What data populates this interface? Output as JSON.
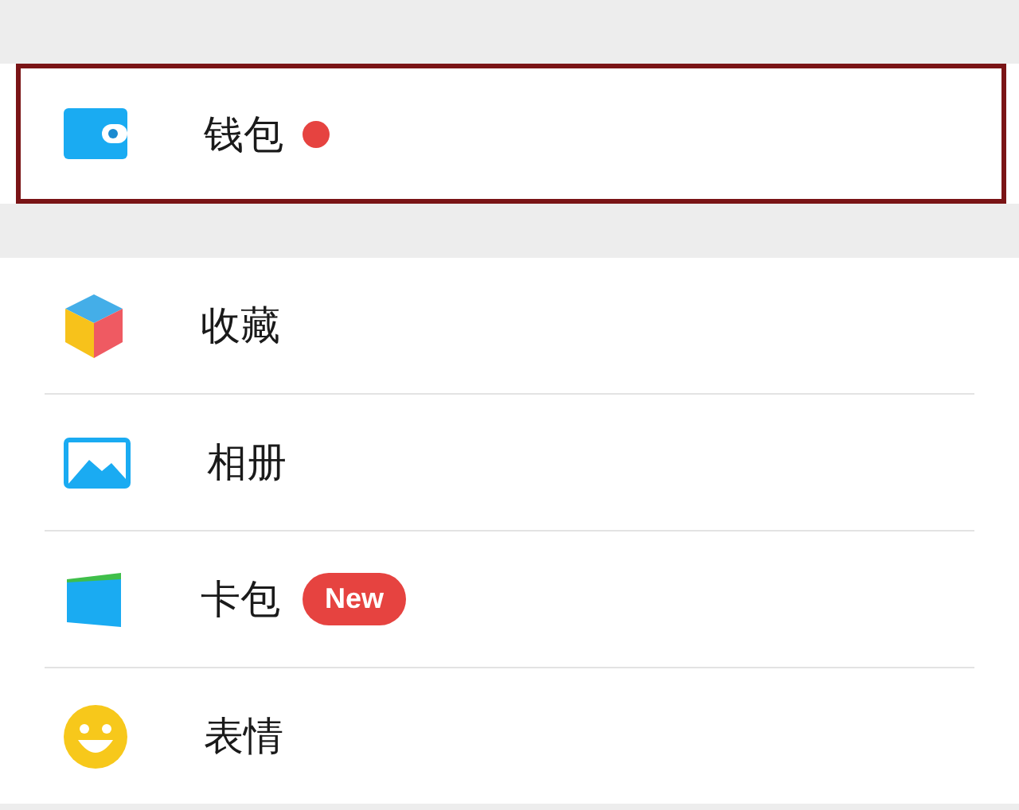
{
  "top_group": [
    {
      "label": "钱包",
      "kind": "wallet",
      "highlighted": true,
      "badge": {
        "kind": "dot"
      }
    }
  ],
  "main_group": [
    {
      "label": "收藏",
      "kind": "cube",
      "highlighted": false
    },
    {
      "label": "相册",
      "kind": "photo",
      "highlighted": false
    },
    {
      "label": "卡包",
      "kind": "card",
      "highlighted": false,
      "badge": {
        "kind": "text",
        "text": "New"
      }
    },
    {
      "label": "表情",
      "kind": "smiley",
      "highlighted": false
    }
  ]
}
